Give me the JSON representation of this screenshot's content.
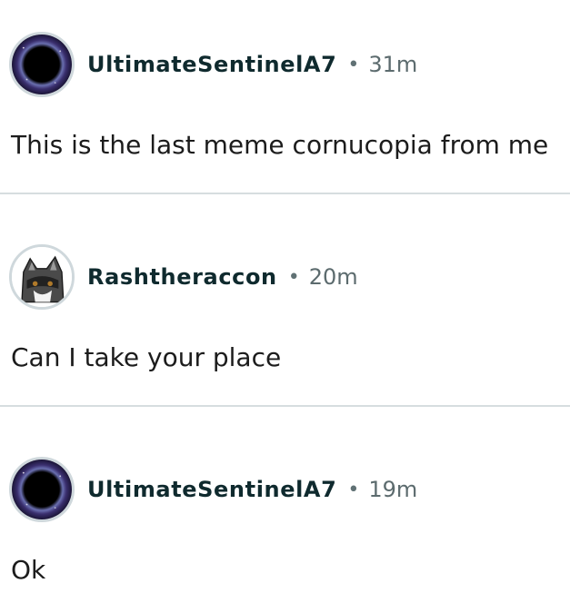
{
  "comments": [
    {
      "username": "UltimateSentinelA7",
      "separator": "•",
      "time": "31m",
      "text": "This is the last meme cornucopia from me",
      "avatar_icon": "black-hole-avatar"
    },
    {
      "username": "Rashtheraccon",
      "separator": "•",
      "time": "20m",
      "text": "Can I take your place",
      "avatar_icon": "raccoon-avatar"
    },
    {
      "username": "UltimateSentinelA7",
      "separator": "•",
      "time": "19m",
      "text": "Ok",
      "avatar_icon": "black-hole-avatar"
    }
  ],
  "colors": {
    "username": "#0f2a2e",
    "meta": "#5c6b6e",
    "divider": "#d6dddf"
  }
}
